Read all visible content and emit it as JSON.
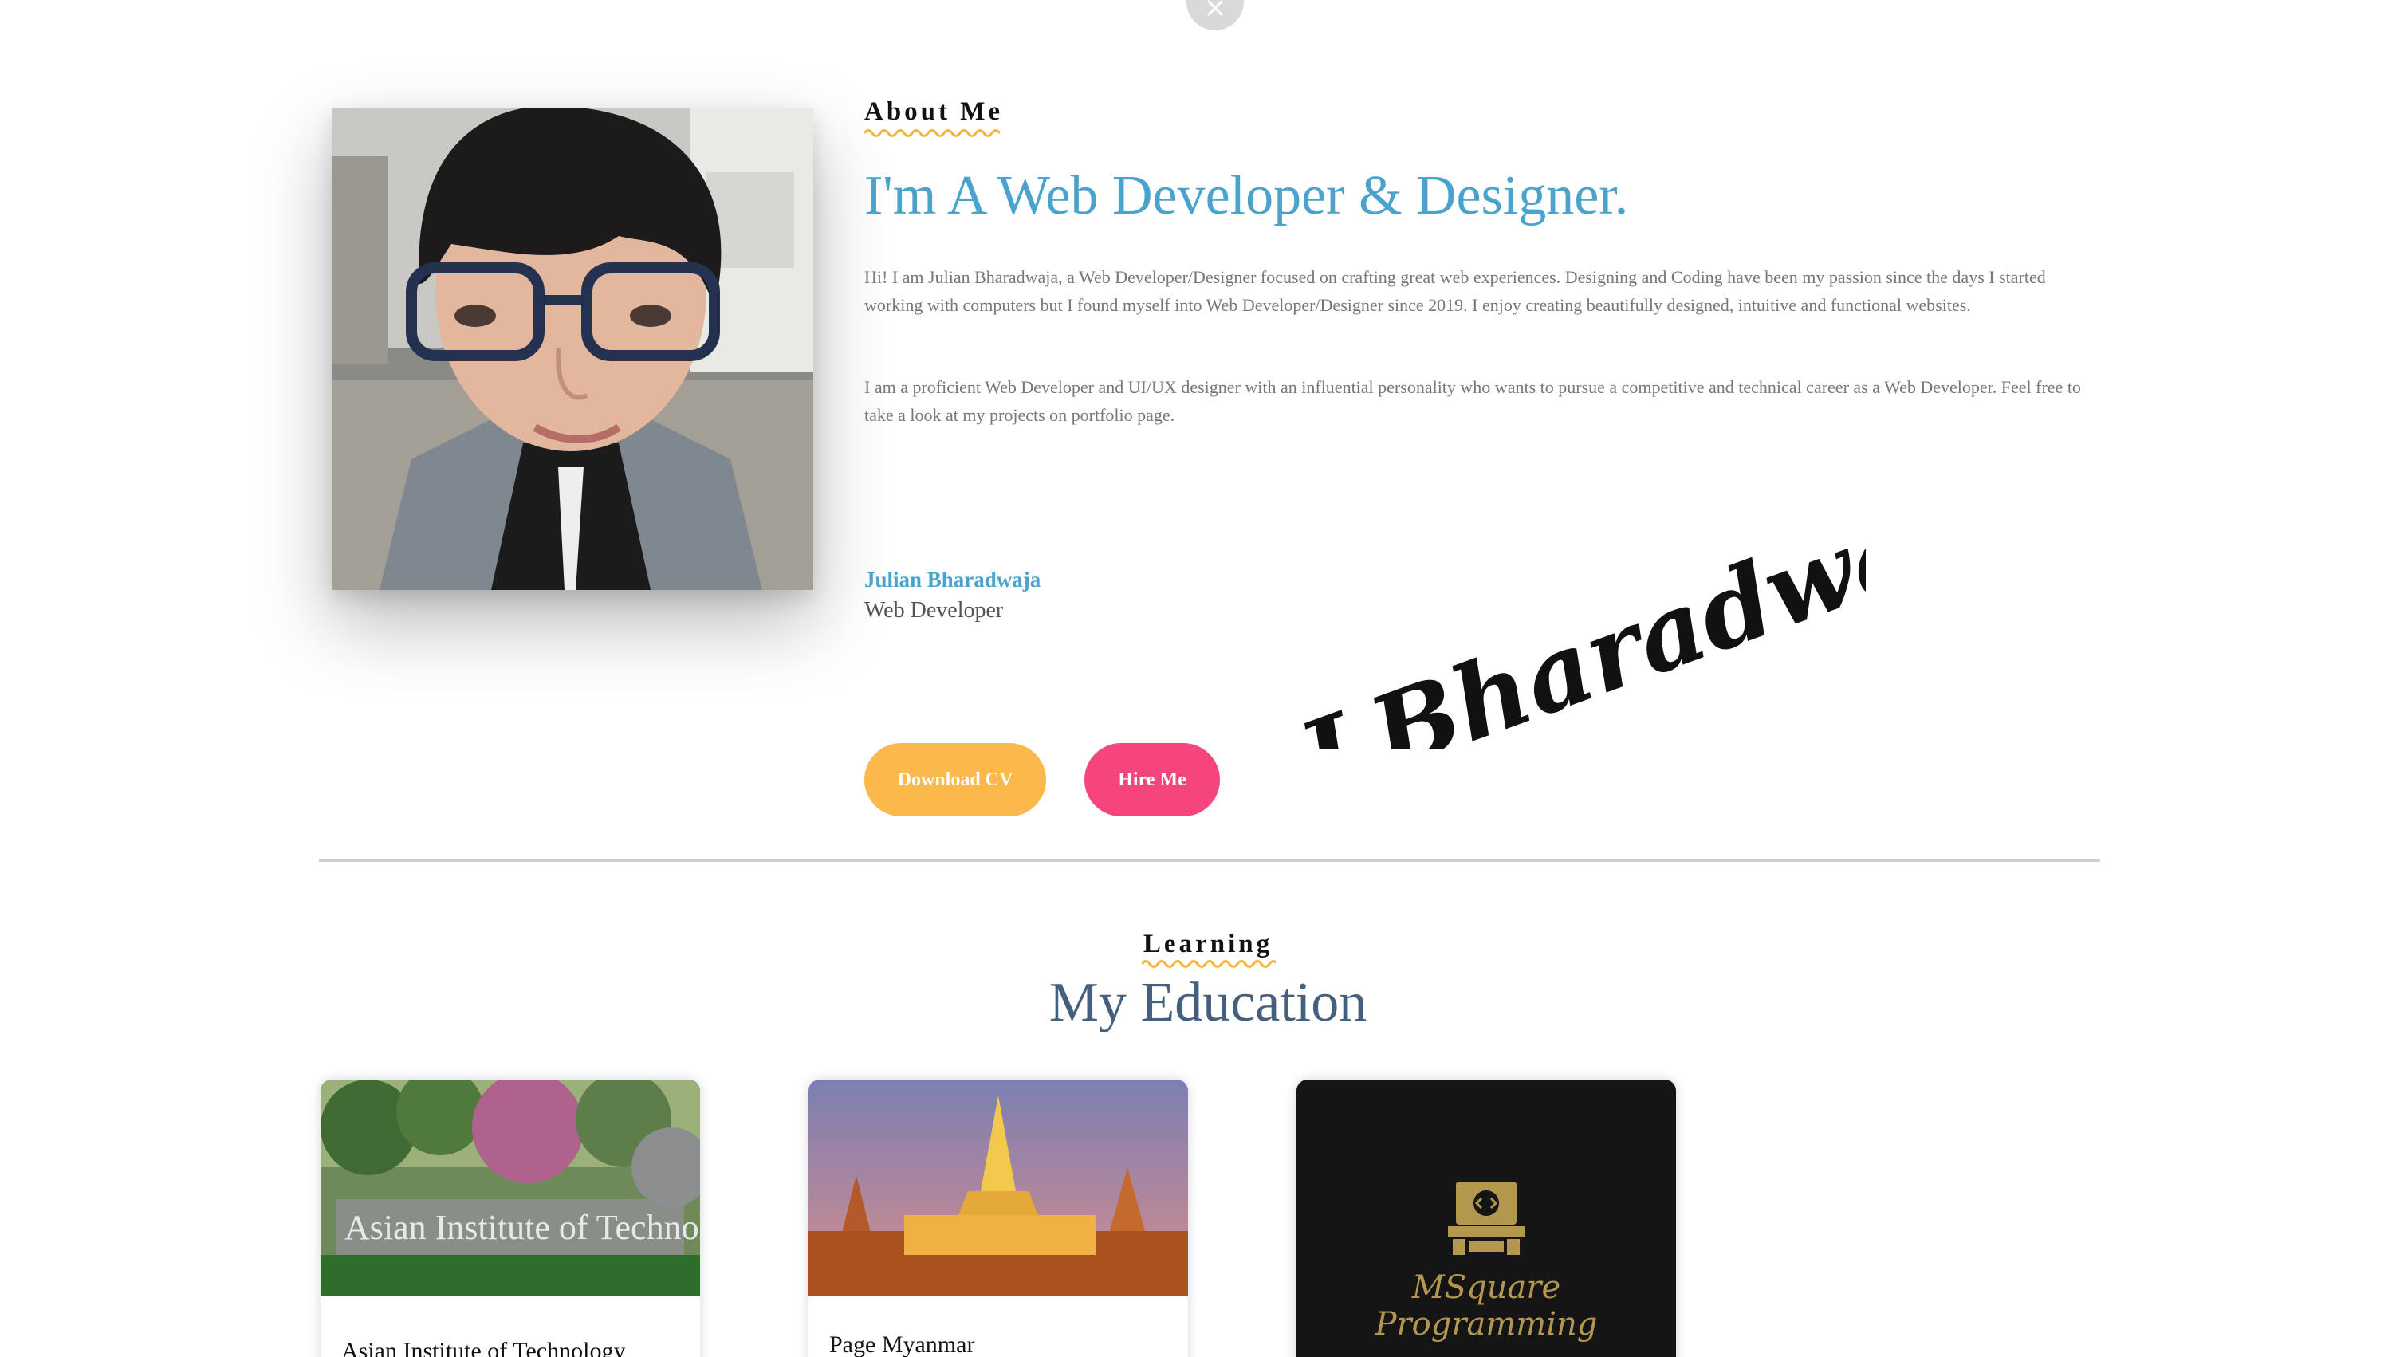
{
  "about": {
    "section_label": "About Me",
    "headline": "I'm A Web Developer & Designer.",
    "paragraph1": "Hi! I am Julian Bharadwaja, a Web Developer/Designer focused on crafting great web experiences. Designing and Coding have been my passion since the days I started working with computers but I found myself into Web Developer/Designer since 2019. I enjoy creating beautifully designed, intuitive and functional websites.",
    "paragraph2": "I am a proficient Web Developer and UI/UX designer with an influential personality who wants to pursue a competitive and technical career as a Web Developer. Feel free to take a look at my projects on portfolio page.",
    "name": "Julian Bharadwaja",
    "role": "Web Developer",
    "signature": "J.Bharadwaja",
    "buttons": {
      "download_cv": "Download CV",
      "hire_me": "Hire Me"
    }
  },
  "education": {
    "section_label": "Learning",
    "title": "My Education",
    "cards": [
      {
        "title": "Asian Institute of Technology",
        "image_text": "Asian Institute of Technology"
      },
      {
        "title": "Page Myanmar"
      },
      {
        "title": "",
        "image_text": "MSquare Programming"
      }
    ]
  },
  "colors": {
    "accent_blue": "#4aa3cc",
    "heading_navy": "#44607e",
    "button_yellow": "#fbb94b",
    "button_pink": "#f5457a",
    "squiggle": "#f5b433"
  },
  "icons": [
    "close-icon",
    "code-laptop-icon"
  ]
}
